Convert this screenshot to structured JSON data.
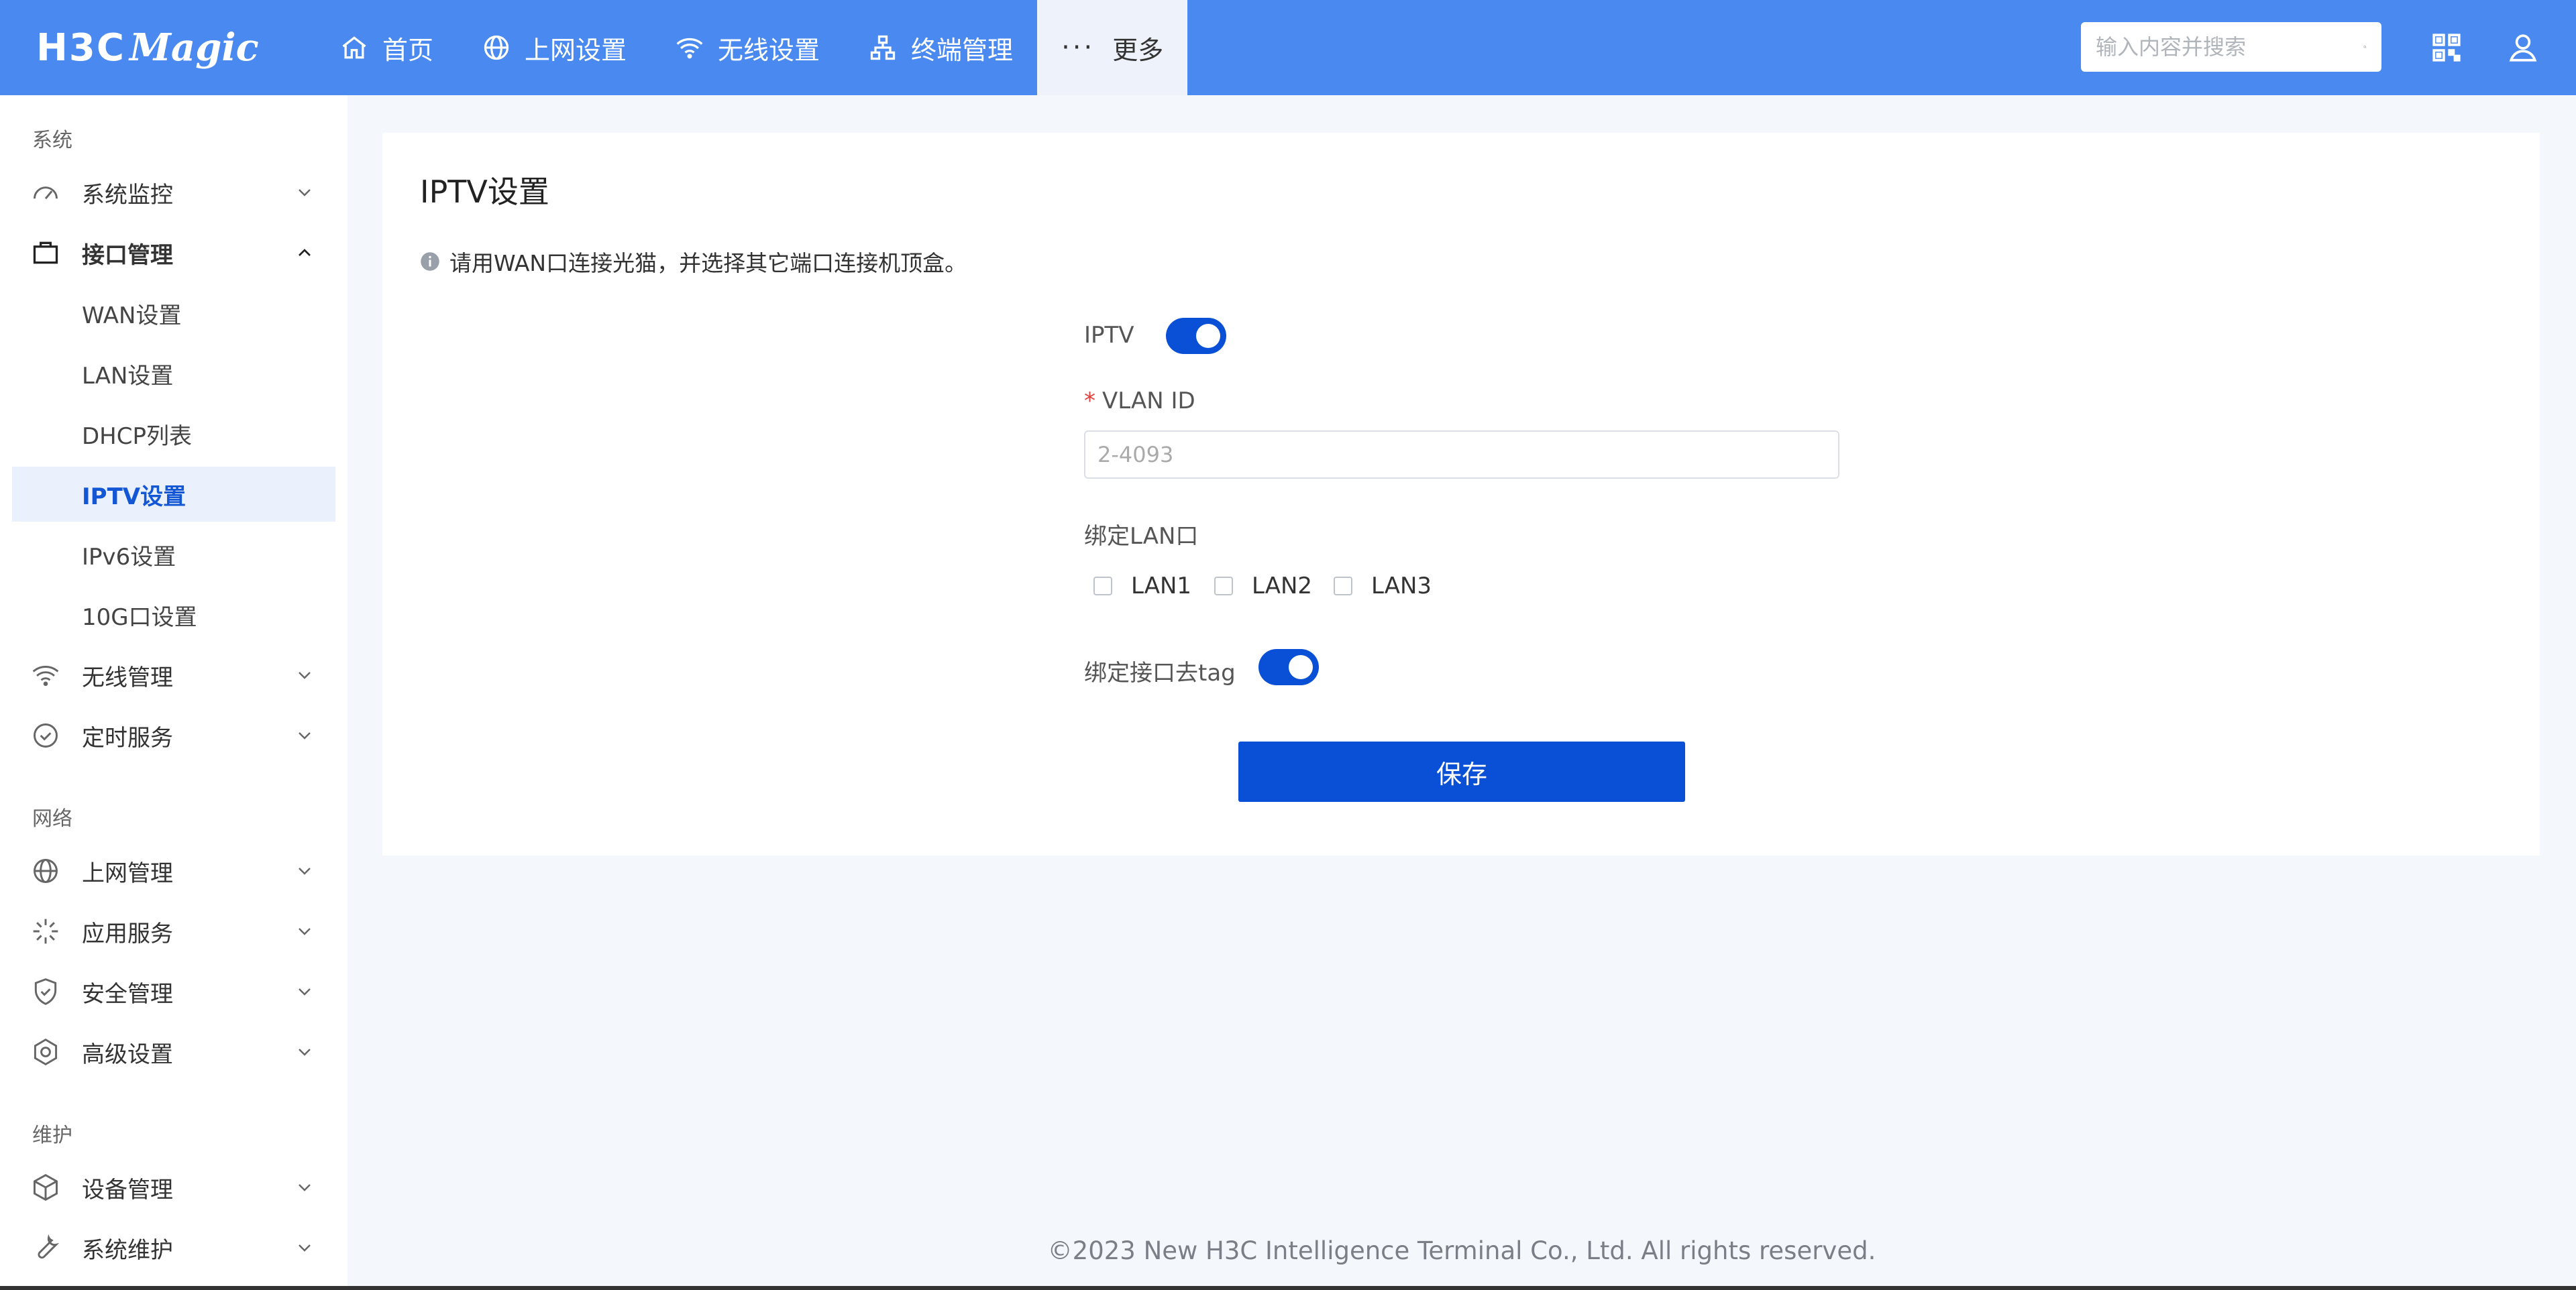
{
  "brand": {
    "logo_h3c": "H3C",
    "logo_magic": "Magic"
  },
  "nav": {
    "items": [
      {
        "label": "首页",
        "icon": "home-icon"
      },
      {
        "label": "上网设置",
        "icon": "globe-icon"
      },
      {
        "label": "无线设置",
        "icon": "wifi-icon"
      },
      {
        "label": "终端管理",
        "icon": "network-icon"
      },
      {
        "label": "更多",
        "icon": "more-icon"
      }
    ],
    "more_dots": "···"
  },
  "search": {
    "placeholder": "输入内容并搜索"
  },
  "sidebar": {
    "groups": [
      {
        "title": "系统"
      },
      {
        "title": "网络"
      },
      {
        "title": "维护"
      }
    ],
    "items": {
      "sys_monitor": "系统监控",
      "iface_mgmt": "接口管理",
      "wireless_mgmt": "无线管理",
      "timer_service": "定时服务",
      "internet_mgmt": "上网管理",
      "app_service": "应用服务",
      "security_mgmt": "安全管理",
      "advanced": "高级设置",
      "device_mgmt": "设备管理",
      "sys_maint": "系统维护"
    },
    "sub_items": {
      "wan": "WAN设置",
      "lan": "LAN设置",
      "dhcp": "DHCP列表",
      "iptv": "IPTV设置",
      "ipv6": "IPv6设置",
      "tenG": "10G口设置"
    }
  },
  "page": {
    "title": "IPTV设置",
    "tip": "请用WAN口连接光猫，并选择其它端口连接机顶盒。",
    "iptv_label": "IPTV",
    "iptv_enabled": true,
    "vlan_required_mark": "*",
    "vlan_label": "VLAN ID",
    "vlan_placeholder": "2-4093",
    "vlan_value": "",
    "bind_lan_label": "绑定LAN口",
    "lan_options": [
      {
        "label": "LAN1",
        "checked": false
      },
      {
        "label": "LAN2",
        "checked": false
      },
      {
        "label": "LAN3",
        "checked": false
      }
    ],
    "untag_label": "绑定接口去tag",
    "untag_enabled": true,
    "save_label": "保存"
  },
  "footer": {
    "copyright": "©2023 New H3C Intelligence Terminal Co., Ltd. All rights reserved."
  },
  "colors": {
    "topbar": "#4a8af0",
    "primary": "#0a50d6",
    "selected_bg": "#eaf1fc"
  }
}
